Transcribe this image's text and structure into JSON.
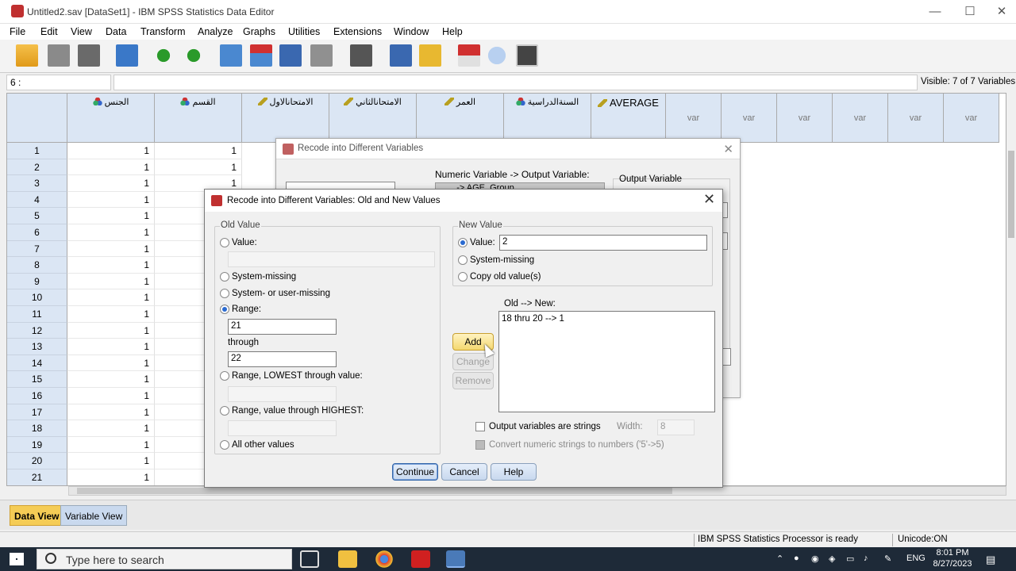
{
  "window": {
    "title": "Untitled2.sav [DataSet1] - IBM SPSS Statistics Data Editor",
    "minimize": "—",
    "maximize": "☐",
    "close": "✕"
  },
  "menu": [
    "File",
    "Edit",
    "View",
    "Data",
    "Transform",
    "Analyze",
    "Graphs",
    "Utilities",
    "Extensions",
    "Window",
    "Help"
  ],
  "cell_ref": "6 :",
  "visible": "Visible: 7 of 7 Variables",
  "columns": [
    {
      "label": "الجنس",
      "measure": "nominal"
    },
    {
      "label": "القسم",
      "measure": "nominal"
    },
    {
      "label": "الامتحانالاول",
      "measure": "scale"
    },
    {
      "label": "الامتحانالثاني",
      "measure": "scale"
    },
    {
      "label": "العمر",
      "measure": "scale"
    },
    {
      "label": "السنةالدراسية",
      "measure": "nominal"
    },
    {
      "label": "AVERAGE",
      "measure": "scale"
    }
  ],
  "var_columns": [
    "var",
    "var",
    "var",
    "var",
    "var",
    "var"
  ],
  "rows": [
    "1",
    "2",
    "3",
    "4",
    "5",
    "6",
    "7",
    "8",
    "9",
    "10",
    "11",
    "12",
    "13",
    "14",
    "15",
    "16",
    "17",
    "18",
    "19",
    "20",
    "21"
  ],
  "cell_value": "1",
  "tabs": {
    "data_view": "Data View",
    "variable_view": "Variable View"
  },
  "status": {
    "processor": "IBM SPSS Statistics Processor is ready",
    "unicode": "Unicode:ON"
  },
  "taskbar": {
    "search_placeholder": "Type here to search",
    "lang": "ENG",
    "time": "8:01 PM",
    "date": "8/27/2023"
  },
  "recode_dialog": {
    "title": "Recode into Different Variables",
    "numeric_label": "Numeric Variable -> Output Variable:",
    "selected_mapping": "... -> AGE_Group",
    "output_variable": "Output Variable"
  },
  "old_new_dialog": {
    "title": "Recode into Different Variables: Old and New Values",
    "old_value": {
      "legend": "Old Value",
      "value_label": "Value:",
      "value_input": "",
      "system_missing": "System-missing",
      "system_user_missing": "System- or user-missing",
      "range_label": "Range:",
      "range_from": "21",
      "through": "through",
      "range_to": "22",
      "range_lowest": "Range, LOWEST through value:",
      "range_highest": "Range, value through HIGHEST:",
      "all_other": "All other values",
      "selected": "range"
    },
    "new_value": {
      "legend": "New Value",
      "value_label": "Value:",
      "value_input": "2",
      "system_missing": "System-missing",
      "copy_old": "Copy old value(s)",
      "selected": "value"
    },
    "old_new_label": "Old --> New:",
    "mappings": [
      "18 thru 20 --> 1"
    ],
    "buttons": {
      "add": "Add",
      "change": "Change",
      "remove": "Remove",
      "continue": "Continue",
      "cancel": "Cancel",
      "help": "Help"
    },
    "output_strings": "Output variables are strings",
    "width_label": "Width:",
    "width_value": "8",
    "convert_numeric": "Convert numeric strings to numbers ('5'->5)"
  }
}
